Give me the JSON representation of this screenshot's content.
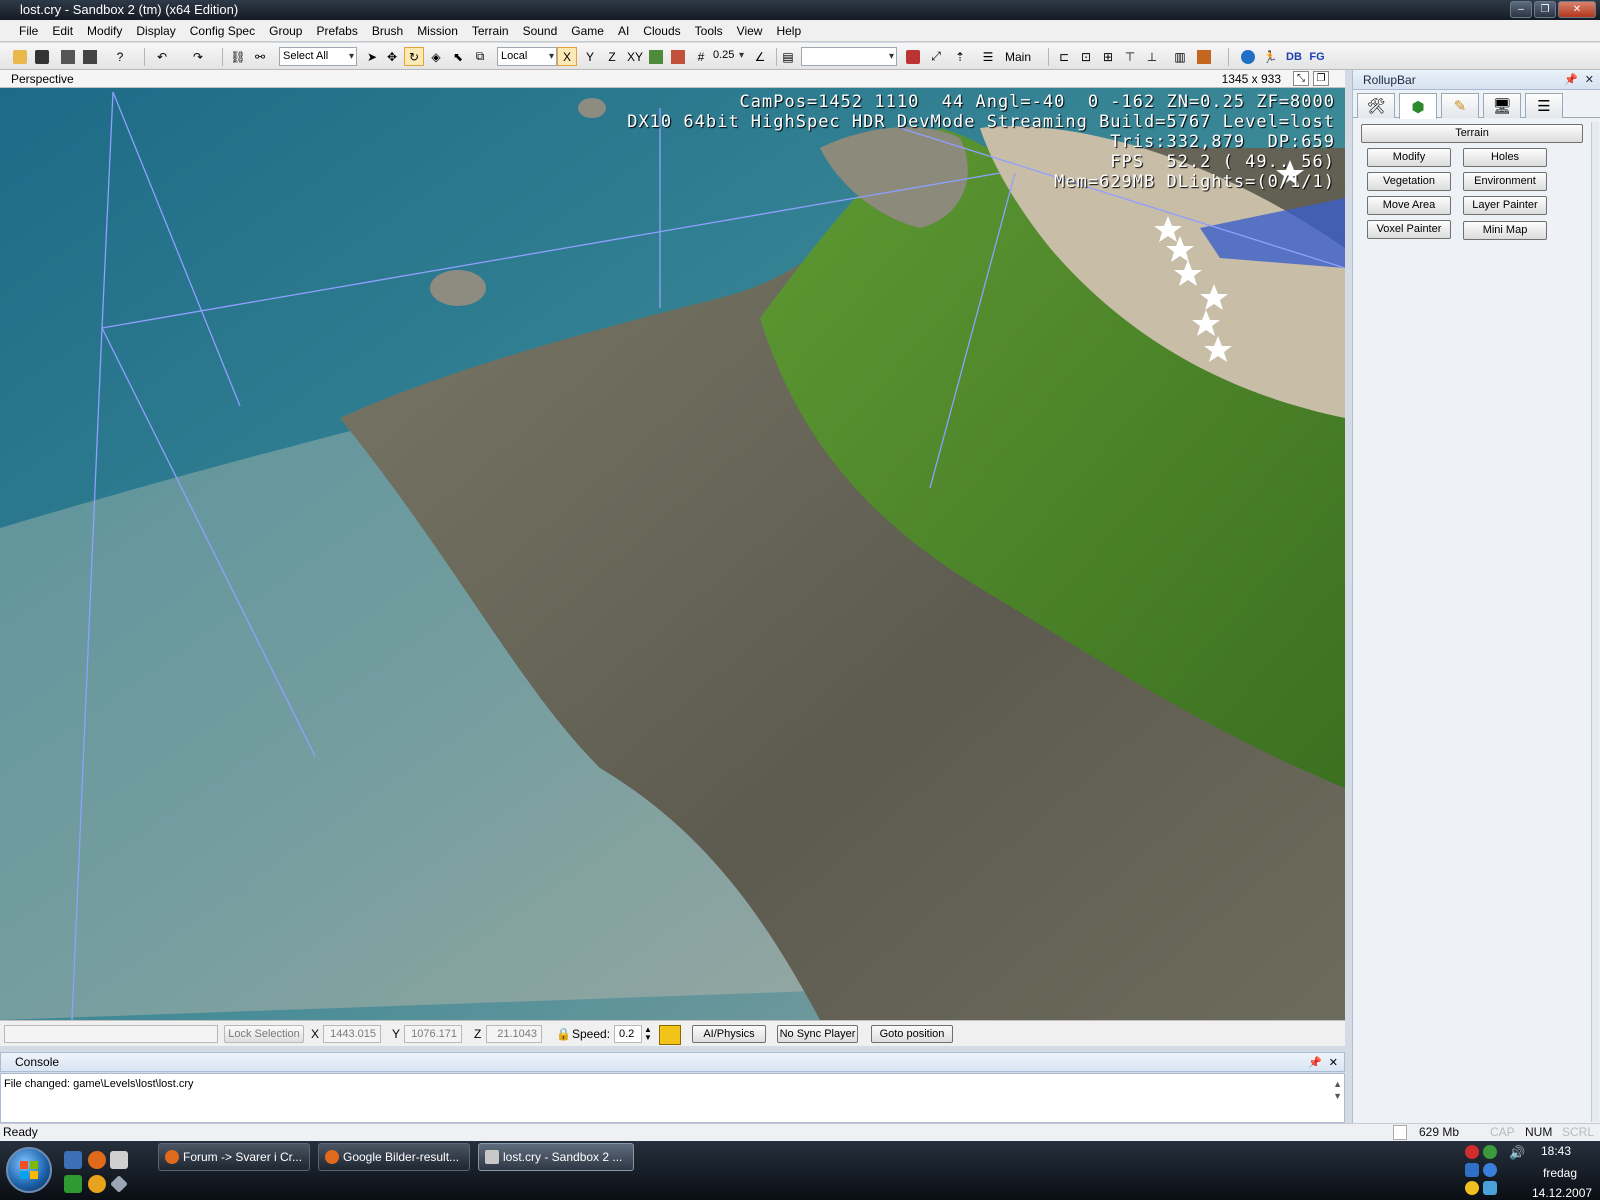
{
  "window": {
    "title": "lost.cry - Sandbox 2 (tm) (x64 Edition)"
  },
  "menu": [
    "File",
    "Edit",
    "Modify",
    "Display",
    "Config Spec",
    "Group",
    "Prefabs",
    "Brush",
    "Mission",
    "Terrain",
    "Sound",
    "Game",
    "AI",
    "Clouds",
    "Tools",
    "View",
    "Help"
  ],
  "toolbar": {
    "select_all": "Select All",
    "coord_system": "Local",
    "axis_x": "X",
    "axis_y": "Y",
    "axis_z": "Z",
    "axis_xy": "XY",
    "grid_size": "0.25",
    "layer_name": "Main",
    "db_label": "DB",
    "fg_label": "FG"
  },
  "viewport": {
    "name": "Perspective",
    "resolution": "1345 x 933",
    "hud": [
      "CamPos=1452 1110  44 Angl=-40  0 -162 ZN=0.25 ZF=8000",
      "DX10 64bit HighSpec HDR DevMode Streaming Build=5767 Level=lost",
      "Tris:332,879  DP:659",
      "FPS  52.2 ( 49.. 56)",
      "Mem=629MB DLights=(0/1/1)"
    ]
  },
  "status_row": {
    "lock_selection": "Lock Selection",
    "x_label": "X",
    "x_value": "1443.015",
    "y_label": "Y",
    "y_value": "1076.171",
    "z_label": "Z",
    "z_value": "21.1043",
    "speed_label": "Speed:",
    "speed_value": "0.2",
    "ai_physics": "AI/Physics",
    "no_sync_player": "No Sync Player",
    "goto_position": "Goto position"
  },
  "console": {
    "title": "Console",
    "line": "File changed: game\\Levels\\lost\\lost.cry"
  },
  "statusbar": {
    "ready": "Ready",
    "memory": "629 Mb",
    "cap": "CAP",
    "num": "NUM",
    "scrl": "SCRL"
  },
  "rollup": {
    "title": "RollupBar",
    "section": "Terrain",
    "buttons": [
      "Modify",
      "Holes",
      "Vegetation",
      "Environment",
      "Move Area",
      "Layer Painter",
      "Voxel Painter",
      "Mini Map"
    ]
  },
  "taskbar": {
    "tasks": [
      "Forum -> Svarer i Cr...",
      "Google Bilder-result...",
      "lost.cry - Sandbox 2 ..."
    ],
    "clock_time": "18:43",
    "clock_day": "fredag",
    "clock_date": "14.12.2007"
  },
  "colors": {
    "water_deep": "#1f6a86",
    "grass": "#4f8a2a",
    "rock": "#6f6d5e",
    "sand": "#cbbfa8",
    "selection_highlight": "#fde9b5"
  }
}
